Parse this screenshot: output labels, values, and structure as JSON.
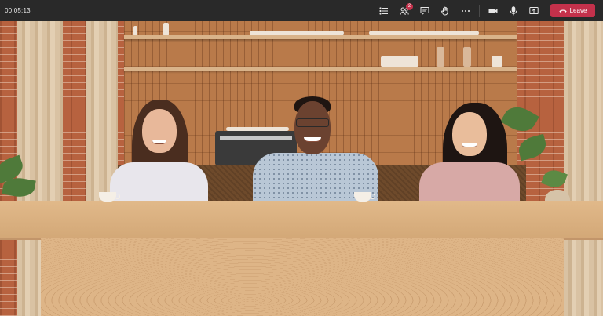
{
  "meeting": {
    "timer": "00:05:13"
  },
  "toolbar": {
    "participants_badge": "2",
    "leave_label": "Leave",
    "icons": [
      "list-icon",
      "people-icon",
      "chat-icon",
      "raise-hand-icon",
      "more-icon",
      "camera-icon",
      "microphone-icon",
      "share-screen-icon",
      "phone-hangup-icon"
    ]
  },
  "colors": {
    "topbar": "#292929",
    "leave_button": "#c4314b",
    "badge": "#c4314b",
    "icon": "#e6e6e6"
  },
  "scene": {
    "mode": "together-mode",
    "participants": [
      "participant-left",
      "participant-center",
      "participant-right"
    ]
  }
}
